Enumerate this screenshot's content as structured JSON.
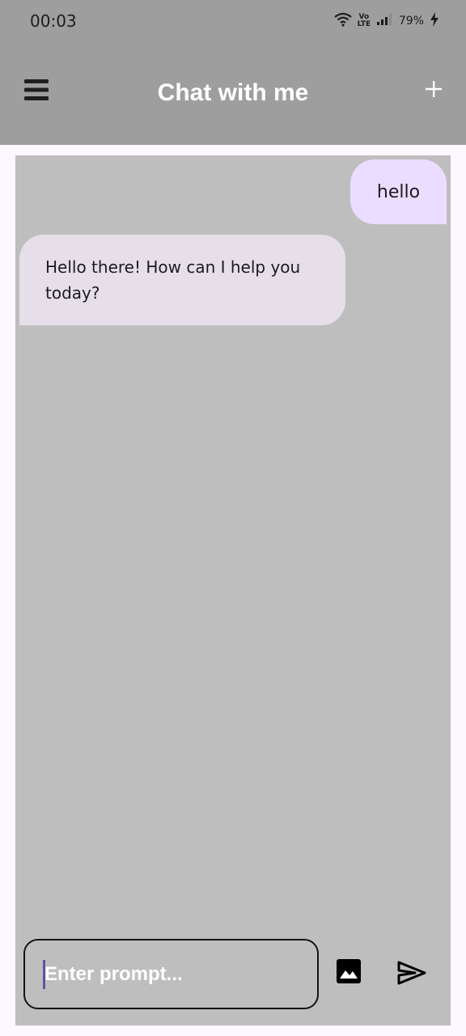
{
  "status_bar": {
    "time": "00:03",
    "battery": "79%",
    "volte_top": "Vo",
    "volte_bottom": "LTE",
    "icons": [
      "wifi-icon",
      "volte-icon",
      "signal-icon",
      "battery-charging-icon"
    ]
  },
  "app_bar": {
    "title": "Chat with me",
    "menu_icon": "menu-icon",
    "new_chat_icon": "plus-icon"
  },
  "messages": [
    {
      "role": "user",
      "text": "hello"
    },
    {
      "role": "assistant",
      "text": "Hello there! How can I help you today?"
    }
  ],
  "composer": {
    "value": "",
    "placeholder": "Enter prompt...",
    "image_icon": "image-icon",
    "send_icon": "send-icon"
  },
  "colors": {
    "app_bar": "#9e9e9e",
    "chat_panel": "#bebebe",
    "page_background": "#fdf7ff",
    "user_bubble": "#ebddff",
    "assistant_bubble": "#e6dfe9",
    "caret": "#6750a4"
  }
}
